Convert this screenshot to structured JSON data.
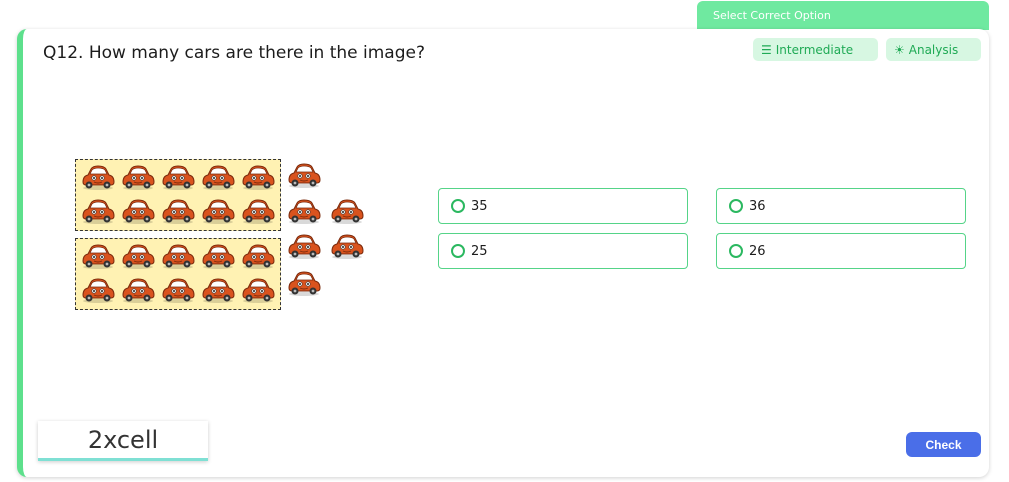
{
  "header_tab": {
    "label": "Select Correct Option"
  },
  "question": {
    "text": "Q12. How many cars are there in the image?"
  },
  "tags": {
    "level": {
      "label": "Intermediate",
      "icon": "sort-up-icon"
    },
    "skill": {
      "label": "Analysis",
      "icon": "bulb-icon"
    }
  },
  "figure": {
    "description_icon": "car-icon",
    "groups": [
      {
        "rows": 2,
        "cols": 5
      },
      {
        "rows": 2,
        "cols": 5
      }
    ],
    "loose_cars": 6
  },
  "options": [
    {
      "label": "35"
    },
    {
      "label": "36"
    },
    {
      "label": "25"
    },
    {
      "label": "26"
    }
  ],
  "logo": {
    "brand": "2xcell"
  },
  "actions": {
    "check_label": "Check"
  },
  "colors": {
    "accent_green": "#5de08c",
    "tab_green": "#6fe9a0",
    "button_blue": "#4a6ee8",
    "car_orange": "#d9531e"
  }
}
